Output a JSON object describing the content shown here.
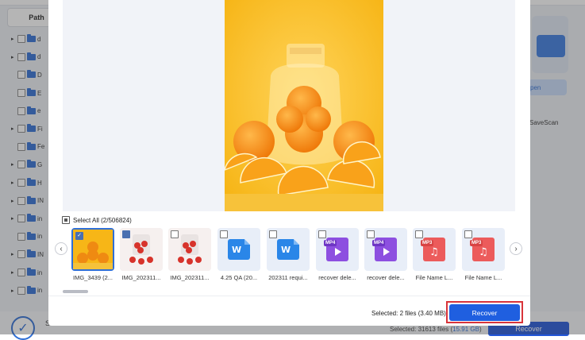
{
  "background": {
    "path_label": "Path",
    "tree_items": [
      {
        "arrow": "▸",
        "label": "d"
      },
      {
        "arrow": "▸",
        "label": "d"
      },
      {
        "arrow": "",
        "label": "D"
      },
      {
        "arrow": "",
        "label": "E"
      },
      {
        "arrow": "",
        "label": "e"
      },
      {
        "arrow": "▸",
        "label": "Fi"
      },
      {
        "arrow": "",
        "label": "Fe"
      },
      {
        "arrow": "▸",
        "label": "G"
      },
      {
        "arrow": "▸",
        "label": "H"
      },
      {
        "arrow": "▸",
        "label": "IN"
      },
      {
        "arrow": "▸",
        "label": "in"
      },
      {
        "arrow": "",
        "label": "in"
      },
      {
        "arrow": "▸",
        "label": "IN"
      },
      {
        "arrow": "▸",
        "label": "in"
      },
      {
        "arrow": "▸",
        "label": "in"
      }
    ],
    "open_label": "pen",
    "savescan_label": "SaveScan",
    "bottom_s": "S",
    "bottom_selected_prefix": "Selected: 31613 files (",
    "bottom_selected_size": "15.91 GB",
    "bottom_selected_suffix": ")",
    "bottom_recover": "Recover"
  },
  "dialog": {
    "select_all_label": "Select All (2/506824)",
    "prev_icon": "‹",
    "next_icon": "›",
    "thumbnails": [
      {
        "label": "IMG_3439 (2...",
        "type": "image-orange",
        "checked": true
      },
      {
        "label": "IMG_202311...",
        "type": "image-tomato",
        "checked": true
      },
      {
        "label": "IMG_202311...",
        "type": "image-tomato",
        "checked": false
      },
      {
        "label": "4.25 QA (20...",
        "type": "doc",
        "checked": false
      },
      {
        "label": "202311 requi...",
        "type": "doc",
        "checked": false
      },
      {
        "label": "recover dele...",
        "type": "mp4",
        "checked": false
      },
      {
        "label": "recover dele...",
        "type": "mp4",
        "checked": false
      },
      {
        "label": "File Name L...",
        "type": "mp3",
        "checked": false
      },
      {
        "label": "File Name L...",
        "type": "mp3",
        "checked": false
      }
    ],
    "doc_letter": "W",
    "mp4_tag": "MP4",
    "mp3_tag": "MP3",
    "music_note": "♫",
    "check_mark": "✓",
    "footer_selected": "Selected: 2 files (3.40 MB)",
    "recover_label": "Recover"
  }
}
